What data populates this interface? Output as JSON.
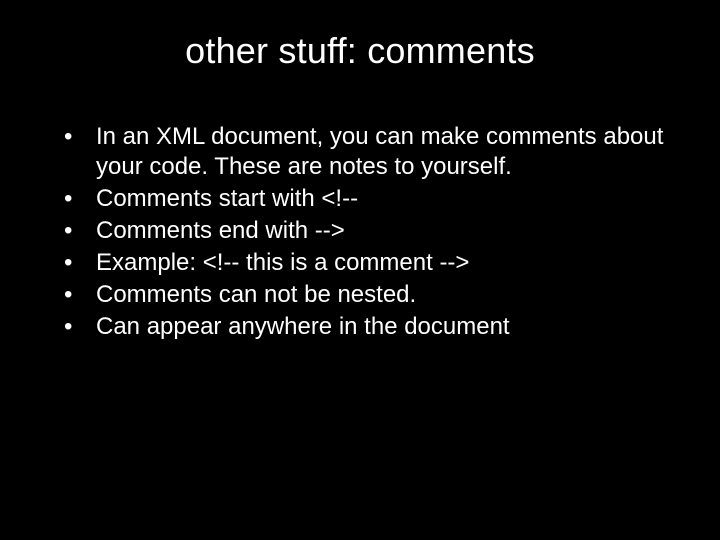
{
  "slide": {
    "title": "other stuff: comments",
    "bullets": [
      "In an XML document, you can make comments about your code. These are notes to yourself.",
      "Comments start with <!--",
      "Comments end with -->",
      "Example: <!-- this is a comment -->",
      "Comments can not be nested.",
      "Can appear anywhere in the document"
    ]
  }
}
